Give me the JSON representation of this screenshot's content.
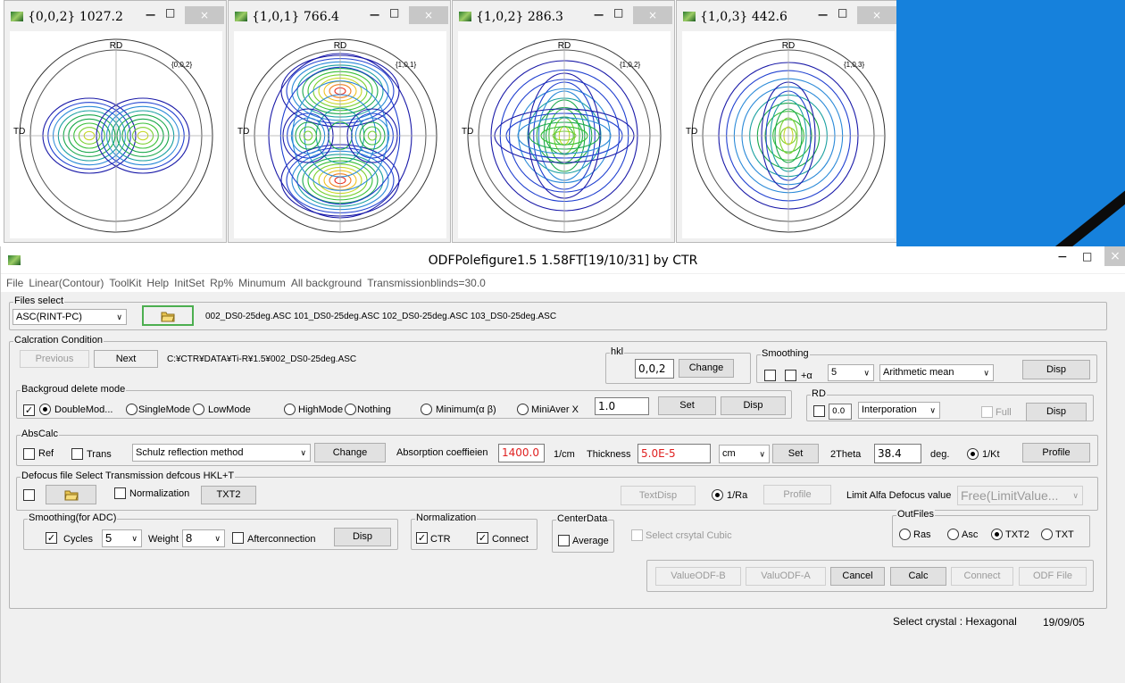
{
  "pole_windows": [
    {
      "title": "{0,0,2} 1027.2",
      "label": "{0,0,2}",
      "rd": "RD",
      "td": "TD"
    },
    {
      "title": "{1,0,1} 766.4",
      "label": "{1,0,1}",
      "rd": "RD",
      "td": "TD"
    },
    {
      "title": "{1,0,2} 286.3",
      "label": "{1,0,2}",
      "rd": "RD",
      "td": "TD"
    },
    {
      "title": "{1,0,3} 442.6",
      "label": "{1,0,3}",
      "rd": "RD",
      "td": "TD"
    }
  ],
  "window_controls": {
    "minimize": "−",
    "maximize": "□",
    "close": "×"
  },
  "main": {
    "title": "ODFPolefigure1.5 1.58FT[19/10/31] by CTR",
    "menu": [
      "File",
      "Linear(Contour)",
      "ToolKit",
      "Help",
      "InitSet",
      "Rp%",
      "Minumum",
      "All background",
      "Transmissionblinds=30.0"
    ],
    "files_select": {
      "label": "Files select",
      "format": "ASC(RINT-PC)",
      "files": "002_DS0-25deg.ASC 101_DS0-25deg.ASC 102_DS0-25deg.ASC 103_DS0-25deg.ASC"
    },
    "calc": {
      "label": "Calcration Condition",
      "previous": "Previous",
      "next": "Next",
      "path": "C:¥CTR¥DATA¥Ti-R¥1.5¥002_DS0-25deg.ASC"
    },
    "hkl": {
      "label": "hkl",
      "value": "0,0,2",
      "change": "Change"
    },
    "smoothing": {
      "label": "Smoothing",
      "plus_alpha": "+α",
      "level": "5",
      "method": "Arithmetic mean",
      "disp": "Disp"
    },
    "background": {
      "label": "Backgroud delete mode",
      "modes": [
        "DoubleMod...",
        "SingleMode",
        "LowMode",
        "HighMode",
        "Nothing",
        "Minimum(α β)",
        "MiniAver X"
      ],
      "value": "1.0",
      "set": "Set",
      "disp": "Disp"
    },
    "rd": {
      "label": "RD",
      "value": "0.0",
      "interp": "Interporation",
      "full": "Full",
      "disp": "Disp"
    },
    "abscalc": {
      "label": "AbsCalc",
      "ref": "Ref",
      "trans": "Trans",
      "method": "Schulz reflection method",
      "change": "Change",
      "absorption_label": "Absorption coeffieien",
      "absorption_value": "1400.0",
      "absorption_unit": "1/cm",
      "thickness_label": "Thickness",
      "thickness_value": "5.0E-5",
      "thickness_unit": "cm",
      "set": "Set",
      "twotheta_label": "2Theta",
      "twotheta_value": "38.4",
      "twotheta_unit": "deg.",
      "kt": "1/Kt",
      "profile": "Profile"
    },
    "defocus": {
      "label": "Defocus file Select Transmission defcous HKL+T",
      "normalization": "Normalization",
      "txt2": "TXT2",
      "textdisp": "TextDisp",
      "ra": "1/Ra",
      "profile": "Profile",
      "limit_label": "Limit Alfa Defocus value",
      "limit_value": "Free(LimitValue..."
    },
    "smoothing_adc": {
      "label": "Smoothing(for ADC)",
      "cycles_label": "Cycles",
      "cycles": "5",
      "weight_label": "Weight",
      "weight": "8",
      "after": "Afterconnection",
      "disp": "Disp"
    },
    "normalization": {
      "label": "Normalization",
      "ctr": "CTR",
      "connect": "Connect"
    },
    "centerdata": {
      "label": "CenterData",
      "average": "Average"
    },
    "select_cubic": "Select crsytal Cubic",
    "outfiles": {
      "label": "OutFiles",
      "options": [
        "Ras",
        "Asc",
        "TXT2",
        "TXT"
      ]
    },
    "actions": [
      "ValueODF-B",
      "ValuODF-A",
      "Cancel",
      "Calc",
      "Connect",
      "ODF File"
    ],
    "status": {
      "crystal": "Select crystal : Hexagonal",
      "date": "19/09/05"
    }
  }
}
